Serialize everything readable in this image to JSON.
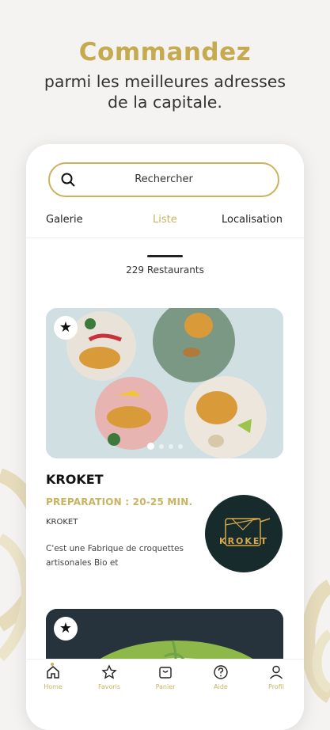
{
  "headline": {
    "title": "Commandez",
    "subtitle_line1": "parmi les meilleures adresses",
    "subtitle_line2": "de la capitale."
  },
  "search": {
    "placeholder": "Rechercher",
    "icon": "search-icon"
  },
  "tabs": [
    {
      "label": "Galerie",
      "active": false
    },
    {
      "label": "Liste",
      "active": true
    },
    {
      "label": "Localisation",
      "active": false
    }
  ],
  "results": {
    "count_label": "229 Restaurants"
  },
  "restaurants": [
    {
      "name": "KROKET",
      "preparation": "PREPARATION : 20-25 MIN.",
      "subtitle": "KROKET",
      "description": "C'est une Fabrique de croquettes artisonales Bio et",
      "logo_text": "KROKET",
      "favorite_icon": "star-icon",
      "carousel_dots": 4,
      "carousel_active": 0
    },
    {
      "favorite_icon": "star-icon"
    }
  ],
  "bottom_nav": [
    {
      "label": "Home",
      "icon": "home-icon",
      "active": true
    },
    {
      "label": "Favoris",
      "icon": "star-outline-icon",
      "active": false
    },
    {
      "label": "Panier",
      "icon": "basket-icon",
      "active": false
    },
    {
      "label": "Aide",
      "icon": "help-icon",
      "active": false
    },
    {
      "label": "Profil",
      "icon": "user-icon",
      "active": false
    }
  ],
  "colors": {
    "accent": "#c9b35f",
    "headline": "#c5aa4f",
    "logo_bg": "#172a2c"
  }
}
